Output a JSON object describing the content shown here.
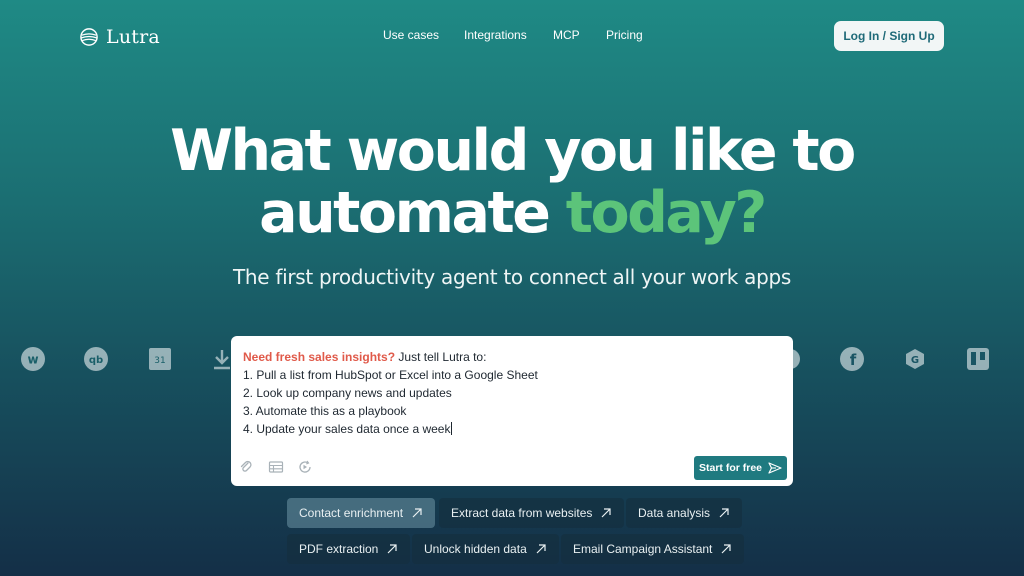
{
  "header": {
    "brand": "Lutra",
    "nav": [
      "Use cases",
      "Integrations",
      "MCP",
      "Pricing"
    ],
    "login_label": "Log In / Sign Up"
  },
  "hero": {
    "line1": "What would you like to",
    "line2_main": "automate",
    "line2_accent": "today?",
    "subtitle": "The first productivity agent to connect all your work apps"
  },
  "app_icons": [
    "webflow-icon",
    "quickbooks-icon",
    "google-calendar-icon",
    "download-icon",
    "app-icon",
    "facebook-icon",
    "gravity-forms-icon",
    "trello-icon"
  ],
  "prompt": {
    "highlight": "Need fresh sales insights?",
    "intro": " Just tell Lutra to:",
    "steps": [
      "1. Pull a list from HubSpot or Excel into a Google Sheet",
      "2. Look up company news and updates",
      "3. Automate this as a playbook",
      "4. Update your sales data once a week"
    ],
    "start_label": "Start for free"
  },
  "chips": [
    {
      "label": "Contact enrichment",
      "active": true
    },
    {
      "label": "Extract data from websites",
      "active": false
    },
    {
      "label": "Data analysis",
      "active": false
    },
    {
      "label": "PDF extraction",
      "active": false
    },
    {
      "label": "Unlock hidden data",
      "active": false
    },
    {
      "label": "Email Campaign Assistant",
      "active": false
    }
  ],
  "colors": {
    "accent_green": "#5cc47a",
    "highlight_red": "#e05a4a",
    "button_teal": "#1f7a80"
  }
}
